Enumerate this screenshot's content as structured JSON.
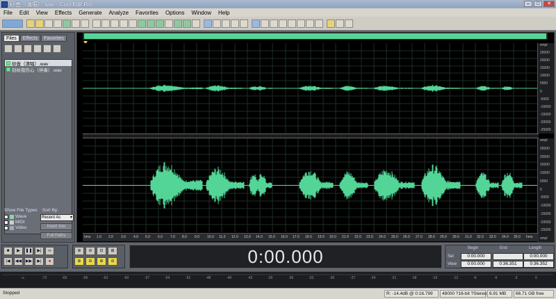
{
  "window": {
    "title": "砂壺（清唱）.wav - Cool Edit Pro"
  },
  "menu": [
    "File",
    "Edit",
    "View",
    "Effects",
    "Generate",
    "Analyze",
    "Favorites",
    "Options",
    "Window",
    "Help"
  ],
  "left_panel": {
    "tabs": [
      "Files",
      "Effects",
      "Favorites"
    ],
    "files": [
      "砂壺（清唱）.wav",
      "别给我伤心（伴奏）.wav"
    ],
    "show_file_types_label": "Show File Types",
    "sort_by_label": "Sort By:",
    "file_types": [
      "Wave",
      "MIDI",
      "Video"
    ],
    "sort_value": "Recent Ac",
    "buttons": [
      "Insert Into",
      "Full Paths"
    ]
  },
  "ruler": {
    "ch1": [
      "smpl",
      "25000",
      "20000",
      "15000",
      "10000",
      "5000",
      "0",
      "-5000",
      "-10000",
      "-15000",
      "-20000",
      "-25000"
    ],
    "ch2": [
      "smpl",
      "25000",
      "20000",
      "15000",
      "10000",
      "5000",
      "0",
      "-5000",
      "-10000",
      "-15000",
      "-20000",
      "-25000",
      "smpl"
    ]
  },
  "timeline": [
    "hms",
    "1.0",
    "2.0",
    "3.0",
    "4.0",
    "5.0",
    "6.0",
    "7.0",
    "8.0",
    "9.0",
    "10.0",
    "11.0",
    "12.0",
    "13.0",
    "14.0",
    "15.0",
    "16.0",
    "17.0",
    "18.0",
    "19.0",
    "20.0",
    "21.0",
    "22.0",
    "23.0",
    "24.0",
    "25.0",
    "26.0",
    "27.0",
    "28.0",
    "29.0",
    "30.0",
    "31.0",
    "32.0",
    "33.0",
    "34.0",
    "35.0",
    "hms"
  ],
  "time_display": "0:00.000",
  "selection": {
    "headers": [
      "Begin",
      "End",
      "Length"
    ],
    "sel_label": "Sel",
    "view_label": "View",
    "sel": [
      "0:00.000",
      "",
      "0:00.000"
    ],
    "view": [
      "0:00.000",
      "0:36.351",
      "0:36.352"
    ]
  },
  "level_meter": [
    "-∞",
    "-72",
    "-69",
    "-66",
    "-63",
    "-60",
    "-57",
    "-54",
    "-51",
    "-48",
    "-45",
    "-42",
    "-39",
    "-36",
    "-33",
    "-30",
    "-27",
    "-24",
    "-21",
    "-18",
    "-15",
    "-12",
    "-9",
    "-6",
    "-3",
    "0"
  ],
  "status": {
    "state": "Stopped",
    "cursor": "R: -14.4dB @  0:16.799",
    "format": "48000 ?16-bit ?Stereo",
    "size": "6.91 MB",
    "free": "66.71 GB free"
  },
  "colors": {
    "waveform": "#53d597",
    "background": "#000000",
    "grid": "#1c2e24"
  }
}
